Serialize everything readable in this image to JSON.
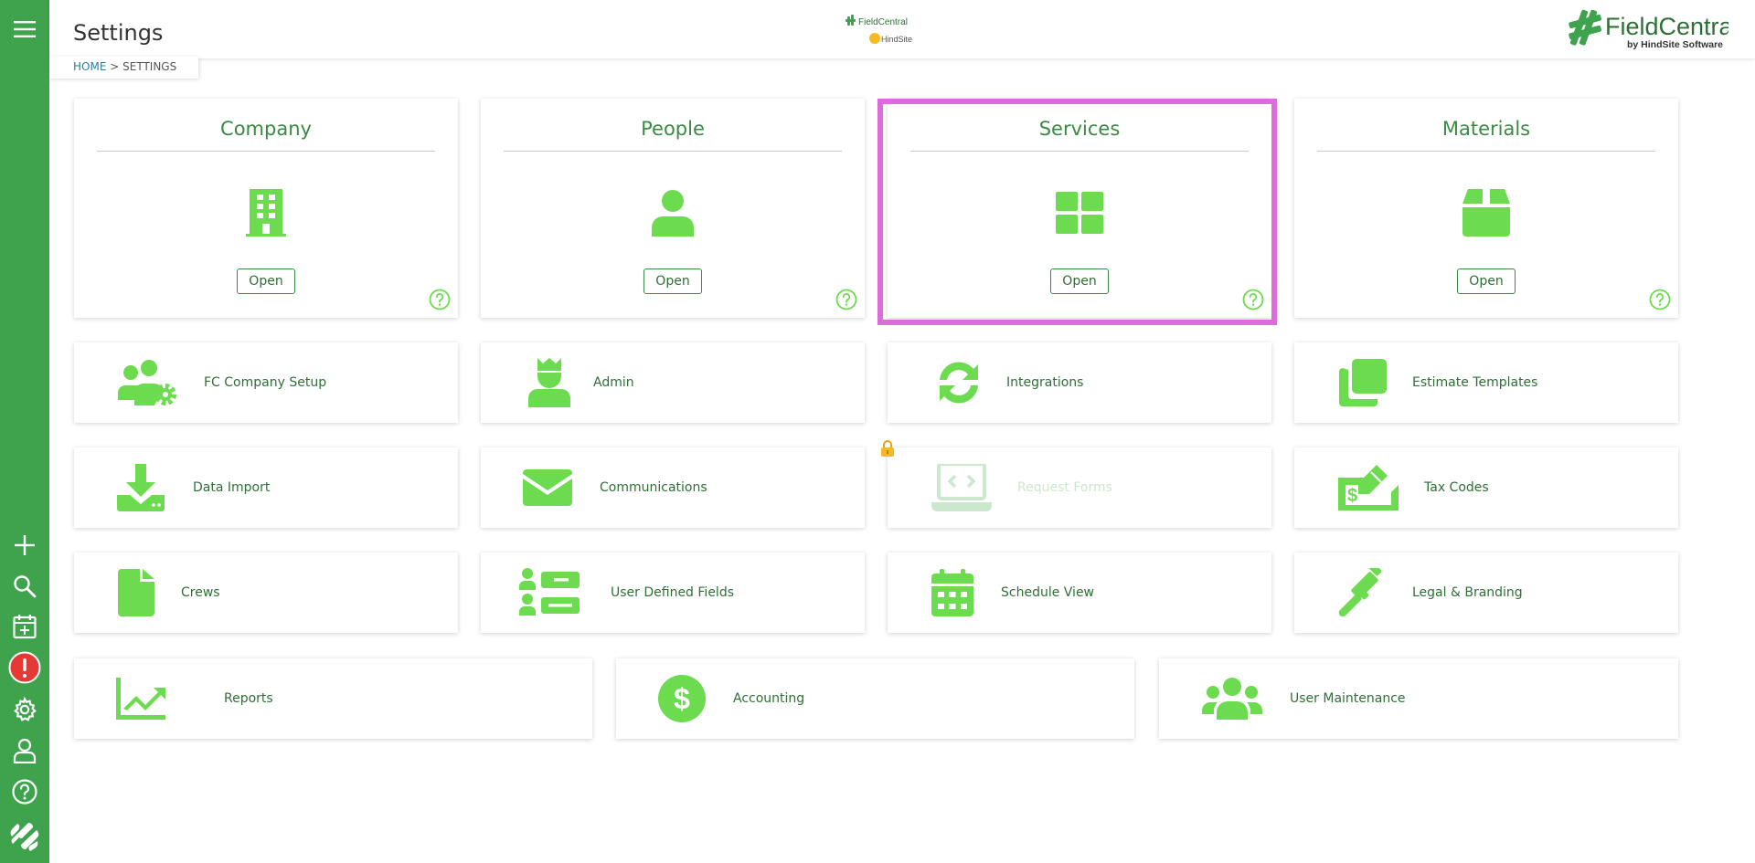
{
  "header": {
    "title": "Settings",
    "breadcrumb": {
      "home": "HOME",
      "separator": ">",
      "current": "SETTINGS"
    },
    "center_logo": {
      "brand": "FieldCentral",
      "sub": "HindSite"
    },
    "right_logo": {
      "brand": "FieldCentral",
      "tagline": "by HindSite Software"
    }
  },
  "sidebar": {
    "icons": [
      "menu-icon",
      "plus-icon",
      "search-icon",
      "calendar-add-icon",
      "alert-icon",
      "gear-icon",
      "user-icon",
      "help-icon",
      "fieldcentral-logo-icon"
    ]
  },
  "big_cards": [
    {
      "title": "Company",
      "icon": "building-icon",
      "button": "Open"
    },
    {
      "title": "People",
      "icon": "person-icon",
      "button": "Open"
    },
    {
      "title": "Services",
      "icon": "grid-icon",
      "button": "Open"
    },
    {
      "title": "Materials",
      "icon": "box-icon",
      "button": "Open"
    }
  ],
  "tiles_row1": [
    {
      "label": "FC Company Setup",
      "icon": "users-gear-icon"
    },
    {
      "label": "Admin",
      "icon": "admin-icon"
    },
    {
      "label": "Integrations",
      "icon": "sync-icon"
    },
    {
      "label": "Estimate Templates",
      "icon": "copy-icon"
    }
  ],
  "tiles_row2": [
    {
      "label": "Data Import",
      "icon": "download-icon"
    },
    {
      "label": "Communications",
      "icon": "envelope-icon"
    },
    {
      "label": "Request Forms",
      "icon": "laptop-code-icon",
      "locked": true
    },
    {
      "label": "Tax Codes",
      "icon": "tax-icon"
    }
  ],
  "tiles_row3": [
    {
      "label": "Crews",
      "icon": "file-icon"
    },
    {
      "label": "User Defined Fields",
      "icon": "user-fields-icon"
    },
    {
      "label": "Schedule View",
      "icon": "calendar-icon"
    },
    {
      "label": "Legal & Branding",
      "icon": "gavel-icon"
    }
  ],
  "tiles_row4": [
    {
      "label": "Reports",
      "icon": "chart-icon"
    },
    {
      "label": "Accounting",
      "icon": "dollar-icon"
    },
    {
      "label": "User Maintenance",
      "icon": "users-icon"
    }
  ],
  "colors": {
    "sidebar": "#3fa34d",
    "icon": "#6cdb4f",
    "text": "#2f6f37",
    "highlight": "#de6bdc",
    "alert": "#e53935"
  }
}
